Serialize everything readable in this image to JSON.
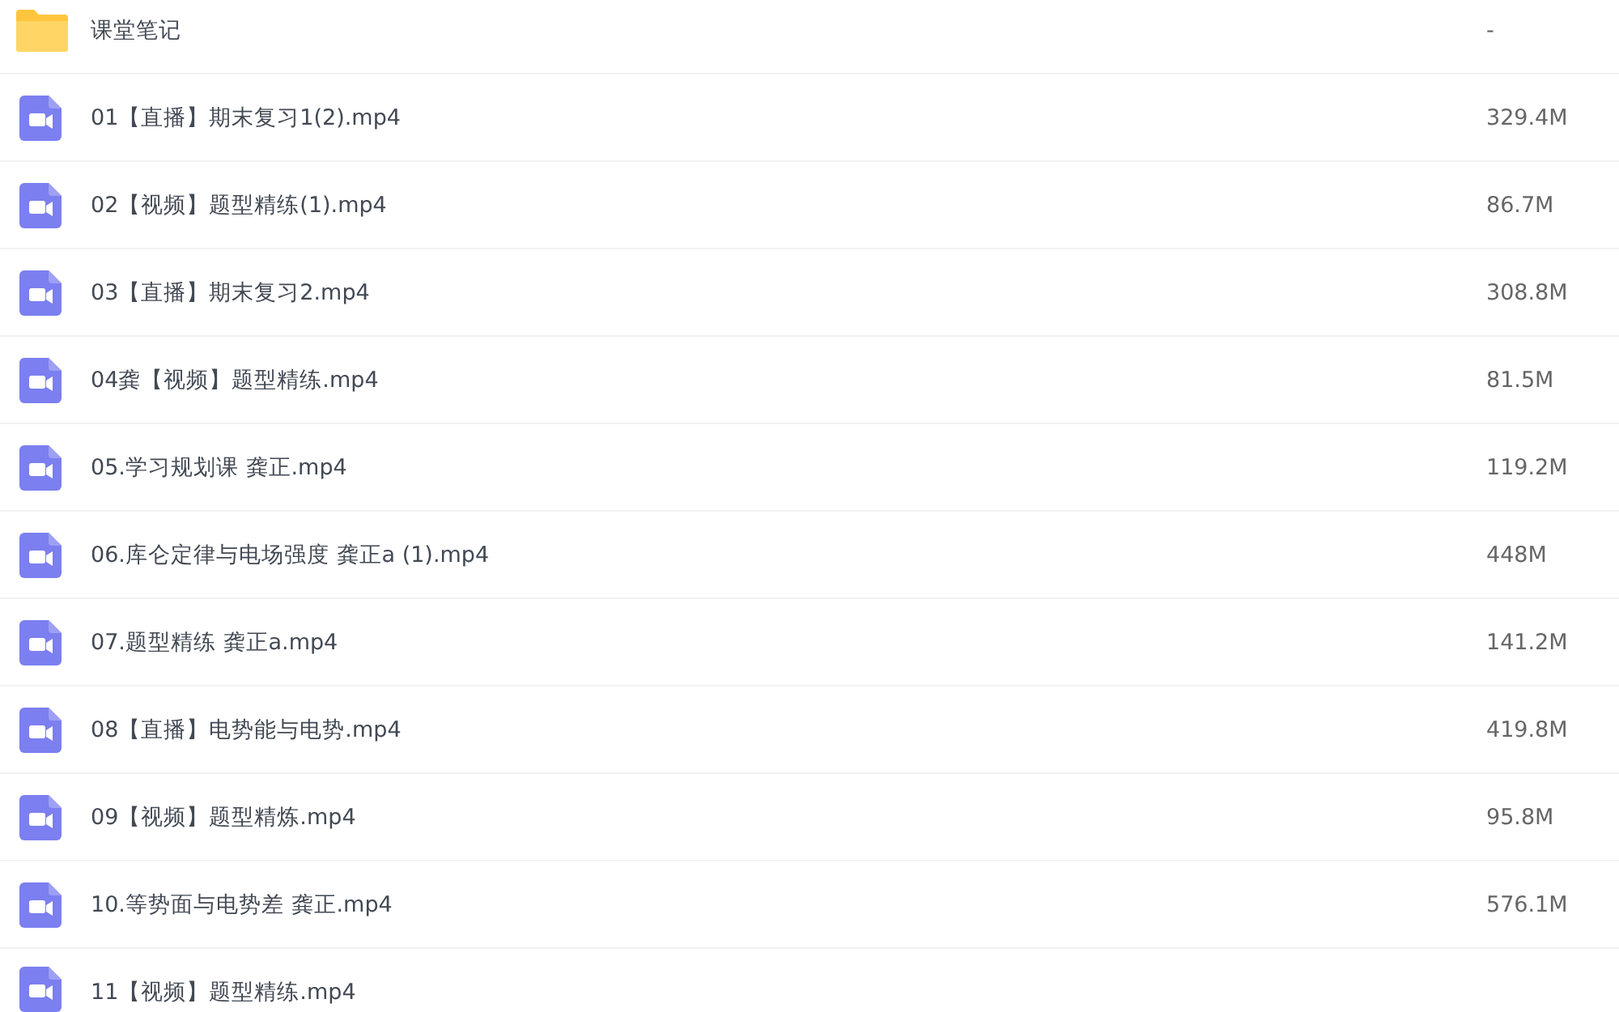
{
  "rows": [
    {
      "kind": "folder",
      "name": "课堂笔记",
      "size": "-"
    },
    {
      "kind": "video",
      "name": "01【直播】期末复习1(2).mp4",
      "size": "329.4M"
    },
    {
      "kind": "video",
      "name": "02【视频】题型精练(1).mp4",
      "size": "86.7M"
    },
    {
      "kind": "video",
      "name": "03【直播】期末复习2.mp4",
      "size": "308.8M"
    },
    {
      "kind": "video",
      "name": "04龚【视频】题型精练.mp4",
      "size": "81.5M"
    },
    {
      "kind": "video",
      "name": "05.学习规划课 龚正.mp4",
      "size": "119.2M"
    },
    {
      "kind": "video",
      "name": "06.库仑定律与电场强度 龚正a (1).mp4",
      "size": "448M"
    },
    {
      "kind": "video",
      "name": "07.题型精练 龚正a.mp4",
      "size": "141.2M"
    },
    {
      "kind": "video",
      "name": "08【直播】电势能与电势.mp4",
      "size": "419.8M"
    },
    {
      "kind": "video",
      "name": "09【视频】题型精炼.mp4",
      "size": "95.8M"
    },
    {
      "kind": "video",
      "name": "10.等势面与电势差 龚正.mp4",
      "size": "576.1M"
    },
    {
      "kind": "video",
      "name": "11【视频】题型精练.mp4"
    }
  ]
}
